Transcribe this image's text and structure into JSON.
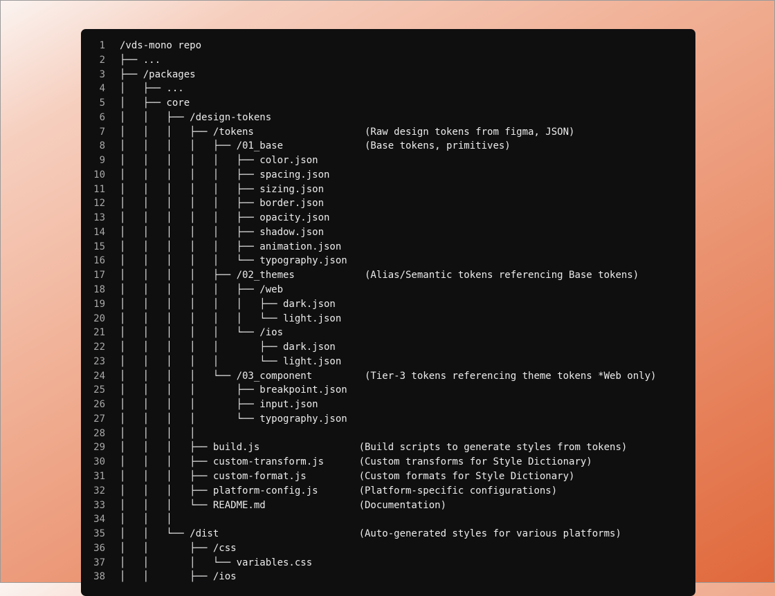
{
  "editor": {
    "lines": [
      {
        "n": "1",
        "text": "/vds-mono repo"
      },
      {
        "n": "2",
        "text": "├── ..."
      },
      {
        "n": "3",
        "text": "├── /packages"
      },
      {
        "n": "4",
        "text": "│   ├── ..."
      },
      {
        "n": "5",
        "text": "│   ├── core"
      },
      {
        "n": "6",
        "text": "│   │   ├── /design-tokens"
      },
      {
        "n": "7",
        "text": "│   │   │   ├── /tokens                   (Raw design tokens from figma, JSON)"
      },
      {
        "n": "8",
        "text": "│   │   │   │   ├── /01_base              (Base tokens, primitives)"
      },
      {
        "n": "9",
        "text": "│   │   │   │   │   ├── color.json"
      },
      {
        "n": "10",
        "text": "│   │   │   │   │   ├── spacing.json"
      },
      {
        "n": "11",
        "text": "│   │   │   │   │   ├── sizing.json"
      },
      {
        "n": "12",
        "text": "│   │   │   │   │   ├── border.json"
      },
      {
        "n": "13",
        "text": "│   │   │   │   │   ├── opacity.json"
      },
      {
        "n": "14",
        "text": "│   │   │   │   │   ├── shadow.json"
      },
      {
        "n": "15",
        "text": "│   │   │   │   │   ├── animation.json"
      },
      {
        "n": "16",
        "text": "│   │   │   │   │   └── typography.json"
      },
      {
        "n": "17",
        "text": "│   │   │   │   ├── /02_themes            (Alias/Semantic tokens referencing Base tokens)"
      },
      {
        "n": "18",
        "text": "│   │   │   │   │   ├── /web"
      },
      {
        "n": "19",
        "text": "│   │   │   │   │   │   ├── dark.json"
      },
      {
        "n": "20",
        "text": "│   │   │   │   │   │   └── light.json"
      },
      {
        "n": "21",
        "text": "│   │   │   │   │   └── /ios"
      },
      {
        "n": "22",
        "text": "│   │   │   │   │       ├── dark.json"
      },
      {
        "n": "23",
        "text": "│   │   │   │   │       └── light.json"
      },
      {
        "n": "24",
        "text": "│   │   │   │   └── /03_component         (Tier-3 tokens referencing theme tokens *Web only)"
      },
      {
        "n": "25",
        "text": "│   │   │   │       ├── breakpoint.json"
      },
      {
        "n": "26",
        "text": "│   │   │   │       ├── input.json"
      },
      {
        "n": "27",
        "text": "│   │   │   │       └── typography.json"
      },
      {
        "n": "28",
        "text": "│   │   │   │"
      },
      {
        "n": "29",
        "text": "│   │   │   ├── build.js                 (Build scripts to generate styles from tokens)"
      },
      {
        "n": "30",
        "text": "│   │   │   ├── custom-transform.js      (Custom transforms for Style Dictionary)"
      },
      {
        "n": "31",
        "text": "│   │   │   ├── custom-format.js         (Custom formats for Style Dictionary)"
      },
      {
        "n": "32",
        "text": "│   │   │   ├── platform-config.js       (Platform-specific configurations)"
      },
      {
        "n": "33",
        "text": "│   │   │   └── README.md                (Documentation)"
      },
      {
        "n": "34",
        "text": "│   │   │"
      },
      {
        "n": "35",
        "text": "│   │   └── /dist                        (Auto-generated styles for various platforms)"
      },
      {
        "n": "36",
        "text": "│   │       ├── /css"
      },
      {
        "n": "37",
        "text": "│   │       │   └── variables.css"
      },
      {
        "n": "38",
        "text": "│   │       ├── /ios"
      }
    ]
  }
}
